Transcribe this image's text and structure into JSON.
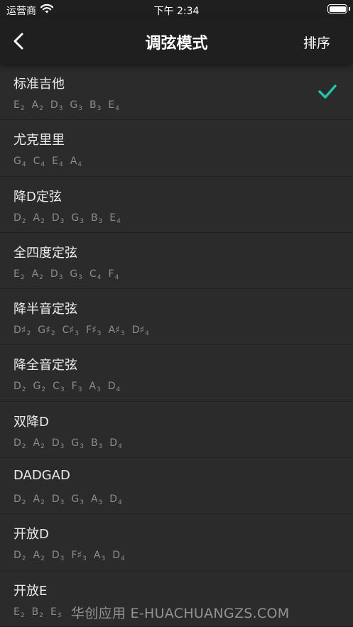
{
  "status_bar": {
    "carrier": "运营商",
    "time": "下午 2:34"
  },
  "nav": {
    "title": "调弦模式",
    "sort_label": "排序"
  },
  "accent_color": "#1fc8ad",
  "tunings": [
    {
      "name": "标准吉他",
      "selected": true,
      "notes": [
        {
          "n": "E",
          "o": "2"
        },
        {
          "n": "A",
          "o": "2"
        },
        {
          "n": "D",
          "o": "3"
        },
        {
          "n": "G",
          "o": "3"
        },
        {
          "n": "B",
          "o": "3"
        },
        {
          "n": "E",
          "o": "4"
        }
      ]
    },
    {
      "name": "尤克里里",
      "selected": false,
      "notes": [
        {
          "n": "G",
          "o": "4"
        },
        {
          "n": "C",
          "o": "4"
        },
        {
          "n": "E",
          "o": "4"
        },
        {
          "n": "A",
          "o": "4"
        }
      ]
    },
    {
      "name": "降D定弦",
      "selected": false,
      "notes": [
        {
          "n": "D",
          "o": "2"
        },
        {
          "n": "A",
          "o": "2"
        },
        {
          "n": "D",
          "o": "3"
        },
        {
          "n": "G",
          "o": "3"
        },
        {
          "n": "B",
          "o": "3"
        },
        {
          "n": "E",
          "o": "4"
        }
      ]
    },
    {
      "name": "全四度定弦",
      "selected": false,
      "notes": [
        {
          "n": "E",
          "o": "2"
        },
        {
          "n": "A",
          "o": "2"
        },
        {
          "n": "D",
          "o": "3"
        },
        {
          "n": "G",
          "o": "3"
        },
        {
          "n": "C",
          "o": "4"
        },
        {
          "n": "F",
          "o": "4"
        }
      ]
    },
    {
      "name": "降半音定弦",
      "selected": false,
      "notes": [
        {
          "n": "D♯",
          "o": "2"
        },
        {
          "n": "G♯",
          "o": "2"
        },
        {
          "n": "C♯",
          "o": "3"
        },
        {
          "n": "F♯",
          "o": "3"
        },
        {
          "n": "A♯",
          "o": "3"
        },
        {
          "n": "D♯",
          "o": "4"
        }
      ]
    },
    {
      "name": "降全音定弦",
      "selected": false,
      "notes": [
        {
          "n": "D",
          "o": "2"
        },
        {
          "n": "G",
          "o": "2"
        },
        {
          "n": "C",
          "o": "3"
        },
        {
          "n": "F",
          "o": "3"
        },
        {
          "n": "A",
          "o": "3"
        },
        {
          "n": "D",
          "o": "4"
        }
      ]
    },
    {
      "name": "双降D",
      "selected": false,
      "notes": [
        {
          "n": "D",
          "o": "2"
        },
        {
          "n": "A",
          "o": "2"
        },
        {
          "n": "D",
          "o": "3"
        },
        {
          "n": "G",
          "o": "3"
        },
        {
          "n": "B",
          "o": "3"
        },
        {
          "n": "D",
          "o": "4"
        }
      ]
    },
    {
      "name": "DADGAD",
      "selected": false,
      "notes": [
        {
          "n": "D",
          "o": "2"
        },
        {
          "n": "A",
          "o": "2"
        },
        {
          "n": "D",
          "o": "3"
        },
        {
          "n": "G",
          "o": "3"
        },
        {
          "n": "A",
          "o": "3"
        },
        {
          "n": "D",
          "o": "4"
        }
      ]
    },
    {
      "name": "开放D",
      "selected": false,
      "notes": [
        {
          "n": "D",
          "o": "2"
        },
        {
          "n": "A",
          "o": "2"
        },
        {
          "n": "D",
          "o": "3"
        },
        {
          "n": "F♯",
          "o": "3"
        },
        {
          "n": "A",
          "o": "3"
        },
        {
          "n": "D",
          "o": "4"
        }
      ]
    },
    {
      "name": "开放E",
      "selected": false,
      "notes": [
        {
          "n": "E",
          "o": "2"
        },
        {
          "n": "B",
          "o": "2"
        },
        {
          "n": "E",
          "o": "3"
        }
      ]
    }
  ],
  "watermark": "华创应用 E-HUACHUANGZS.COM"
}
